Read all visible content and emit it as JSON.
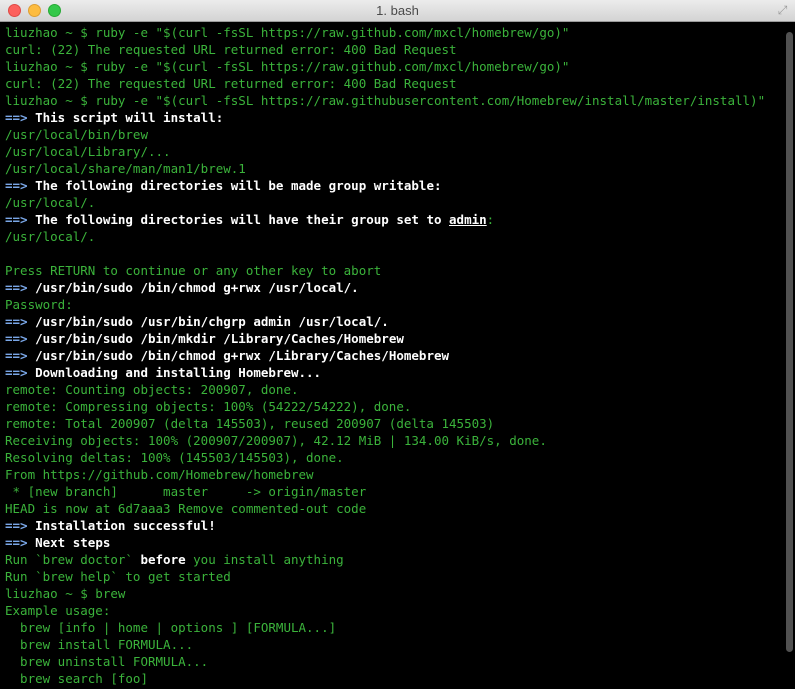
{
  "window": {
    "title": "1. bash"
  },
  "terminal": {
    "lines": [
      [
        {
          "c": "g",
          "t": "liuzhao ~ $ ruby -e \"$(curl -fsSL https://raw.github.com/mxcl/homebrew/go)\""
        }
      ],
      [
        {
          "c": "g",
          "t": "curl: (22) The requested URL returned error: 400 Bad Request"
        }
      ],
      [
        {
          "c": "g",
          "t": "liuzhao ~ $ ruby -e \"$(curl -fsSL https://raw.github.com/mxcl/homebrew/go)\""
        }
      ],
      [
        {
          "c": "g",
          "t": "curl: (22) The requested URL returned error: 400 Bad Request"
        }
      ],
      [
        {
          "c": "g",
          "t": "liuzhao ~ $ ruby -e \"$(curl -fsSL https://raw.githubusercontent.com/Homebrew/install/master/install)\""
        }
      ],
      [
        {
          "c": "a",
          "t": "==> "
        },
        {
          "c": "w",
          "t": "This script will install:"
        }
      ],
      [
        {
          "c": "g",
          "t": "/usr/local/bin/brew"
        }
      ],
      [
        {
          "c": "g",
          "t": "/usr/local/Library/..."
        }
      ],
      [
        {
          "c": "g",
          "t": "/usr/local/share/man/man1/brew.1"
        }
      ],
      [
        {
          "c": "a",
          "t": "==> "
        },
        {
          "c": "w",
          "t": "The following directories will be made group writable:"
        }
      ],
      [
        {
          "c": "g",
          "t": "/usr/local/."
        }
      ],
      [
        {
          "c": "a",
          "t": "==> "
        },
        {
          "c": "w",
          "t": "The following directories will have their group set to "
        },
        {
          "c": "w u",
          "t": "admin"
        },
        {
          "c": "g",
          "t": ":"
        }
      ],
      [
        {
          "c": "g",
          "t": "/usr/local/."
        }
      ],
      [
        {
          "c": "g",
          "t": ""
        }
      ],
      [
        {
          "c": "g",
          "t": "Press RETURN to continue or any other key to abort"
        }
      ],
      [
        {
          "c": "a",
          "t": "==> "
        },
        {
          "c": "w",
          "t": "/usr/bin/sudo /bin/chmod g+rwx /usr/local/."
        }
      ],
      [
        {
          "c": "g",
          "t": "Password:"
        }
      ],
      [
        {
          "c": "a",
          "t": "==> "
        },
        {
          "c": "w",
          "t": "/usr/bin/sudo /usr/bin/chgrp admin /usr/local/."
        }
      ],
      [
        {
          "c": "a",
          "t": "==> "
        },
        {
          "c": "w",
          "t": "/usr/bin/sudo /bin/mkdir /Library/Caches/Homebrew"
        }
      ],
      [
        {
          "c": "a",
          "t": "==> "
        },
        {
          "c": "w",
          "t": "/usr/bin/sudo /bin/chmod g+rwx /Library/Caches/Homebrew"
        }
      ],
      [
        {
          "c": "a",
          "t": "==> "
        },
        {
          "c": "w",
          "t": "Downloading and installing Homebrew..."
        }
      ],
      [
        {
          "c": "g",
          "t": "remote: Counting objects: 200907, done."
        }
      ],
      [
        {
          "c": "g",
          "t": "remote: Compressing objects: 100% (54222/54222), done."
        }
      ],
      [
        {
          "c": "g",
          "t": "remote: Total 200907 (delta 145503), reused 200907 (delta 145503)"
        }
      ],
      [
        {
          "c": "g",
          "t": "Receiving objects: 100% (200907/200907), 42.12 MiB | 134.00 KiB/s, done."
        }
      ],
      [
        {
          "c": "g",
          "t": "Resolving deltas: 100% (145503/145503), done."
        }
      ],
      [
        {
          "c": "g",
          "t": "From https://github.com/Homebrew/homebrew"
        }
      ],
      [
        {
          "c": "g",
          "t": " * [new branch]      master     -> origin/master"
        }
      ],
      [
        {
          "c": "g",
          "t": "HEAD is now at 6d7aaa3 Remove commented-out code"
        }
      ],
      [
        {
          "c": "a",
          "t": "==> "
        },
        {
          "c": "w",
          "t": "Installation successful!"
        }
      ],
      [
        {
          "c": "a",
          "t": "==> "
        },
        {
          "c": "w",
          "t": "Next steps"
        }
      ],
      [
        {
          "c": "g",
          "t": "Run `brew doctor` "
        },
        {
          "c": "w",
          "t": "before"
        },
        {
          "c": "g",
          "t": " you install anything"
        }
      ],
      [
        {
          "c": "g",
          "t": "Run `brew help` to get started"
        }
      ],
      [
        {
          "c": "g",
          "t": "liuzhao ~ $ brew"
        }
      ],
      [
        {
          "c": "g",
          "t": "Example usage:"
        }
      ],
      [
        {
          "c": "g",
          "t": "  brew [info | home | options ] [FORMULA...]"
        }
      ],
      [
        {
          "c": "g",
          "t": "  brew install FORMULA..."
        }
      ],
      [
        {
          "c": "g",
          "t": "  brew uninstall FORMULA..."
        }
      ],
      [
        {
          "c": "g",
          "t": "  brew search [foo]"
        }
      ]
    ]
  },
  "colors": {
    "background": "#000000",
    "green_text": "#3bb33b",
    "bold_text": "#ffffff",
    "arrow_blue": "#7aa7e8"
  },
  "icons": {
    "close": "close-icon",
    "minimize": "minimize-icon",
    "zoom": "zoom-icon",
    "fullscreen": "fullscreen-arrows-icon"
  }
}
